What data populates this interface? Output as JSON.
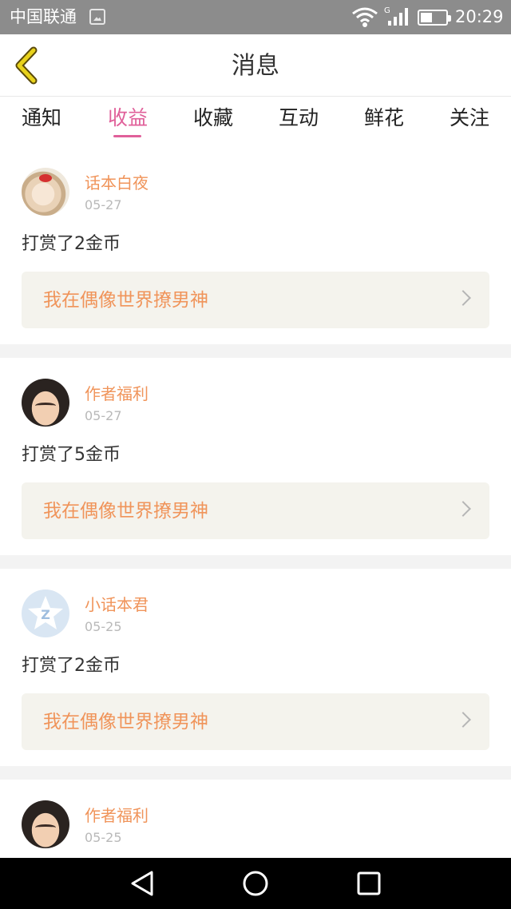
{
  "status_bar": {
    "carrier": "中国联通",
    "network_type": "G",
    "time": "20:29",
    "battery_level": 0.45,
    "icons": [
      "image-notification-icon",
      "wifi-icon",
      "signal-icon",
      "battery-icon"
    ]
  },
  "header": {
    "title": "消息",
    "back_icon": "chevron-left-icon",
    "back_color": "#e8d21c"
  },
  "tabs": [
    {
      "label": "通知",
      "active": false
    },
    {
      "label": "收益",
      "active": true
    },
    {
      "label": "收藏",
      "active": false
    },
    {
      "label": "互动",
      "active": false
    },
    {
      "label": "鲜花",
      "active": false
    },
    {
      "label": "关注",
      "active": false
    }
  ],
  "colors": {
    "accent": "#e0609a",
    "author": "#f0945a",
    "link_bg": "#f4f3ed",
    "divider": "#f3f3f3"
  },
  "messages": [
    {
      "author": "话本白夜",
      "date": "05-27",
      "text": "打赏了2金币",
      "book": "我在偶像世界撩男神",
      "avatar": "photo-avatar-icon"
    },
    {
      "author": "作者福利",
      "date": "05-27",
      "text": "打赏了5金币",
      "book": "我在偶像世界撩男神",
      "avatar": "face-avatar-icon"
    },
    {
      "author": "小话本君",
      "date": "05-25",
      "text": "打赏了2金币",
      "book": "我在偶像世界撩男神",
      "avatar": "qq-avatar-icon"
    },
    {
      "author": "作者福利",
      "date": "05-25",
      "avatar": "face-avatar-icon"
    }
  ],
  "nav_bar": {
    "icons": [
      "back-triangle-icon",
      "home-circle-icon",
      "recents-square-icon"
    ]
  }
}
